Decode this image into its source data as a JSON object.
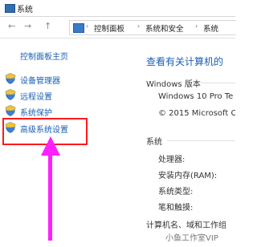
{
  "window": {
    "title": "系统"
  },
  "nav": {
    "back_arrow": "←",
    "forward_arrow": "→",
    "up_arrow": "↑",
    "breadcrumb": [
      "控制面板",
      "系统和安全",
      "系统"
    ],
    "separator": "›"
  },
  "sidebar": {
    "home": "控制面板主页",
    "items": [
      {
        "label": "设备管理器",
        "icon": "shield-icon"
      },
      {
        "label": "远程设置",
        "icon": "shield-icon"
      },
      {
        "label": "系统保护",
        "icon": "shield-icon"
      },
      {
        "label": "高级系统设置",
        "icon": "shield-icon"
      }
    ]
  },
  "main": {
    "title": "查看有关计算机的",
    "windows_section": {
      "heading": "Windows 版本",
      "lines": [
        "Windows 10 Pro Te",
        "© 2015 Microsoft C"
      ]
    },
    "system_section": {
      "heading": "系统",
      "rows": [
        "处理器:",
        "安装内存(RAM):",
        "系统类型:",
        "笔和触摸:"
      ]
    },
    "computer_section": {
      "heading": "计算机名、域和工作组"
    }
  },
  "watermark": "小鱼工作室VIP",
  "colors": {
    "link": "#1a5fb4",
    "highlight_border": "#ff1a1a",
    "arrow": "#ff20ff"
  }
}
